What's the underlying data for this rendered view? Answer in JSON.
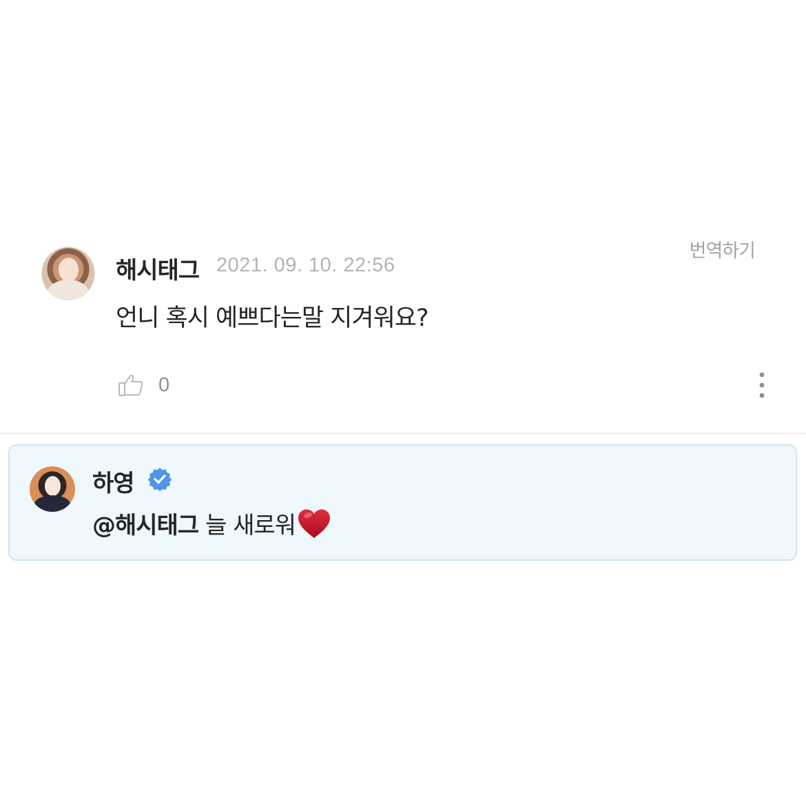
{
  "comment": {
    "author": "해시태그",
    "timestamp": "2021. 09. 10. 22:56",
    "translate_label": "번역하기",
    "text": "언니 혹시 예쁘다는말 지겨워요?",
    "like_count": "0",
    "icons": {
      "like": "thumbs-up-icon",
      "more": "more-vertical-icon"
    }
  },
  "reply": {
    "author": "하영",
    "mention": "@해시태그",
    "text": "늘 새로워",
    "icons": {
      "verified": "verified-badge-icon",
      "heart": "heart-icon"
    }
  },
  "colors": {
    "timestamp": "#b4b4b4",
    "reply_background": "#eef8fd",
    "reply_border": "#cfe3ef",
    "verified_blue": "#4f95e8",
    "heart_red": "#c9162b"
  }
}
